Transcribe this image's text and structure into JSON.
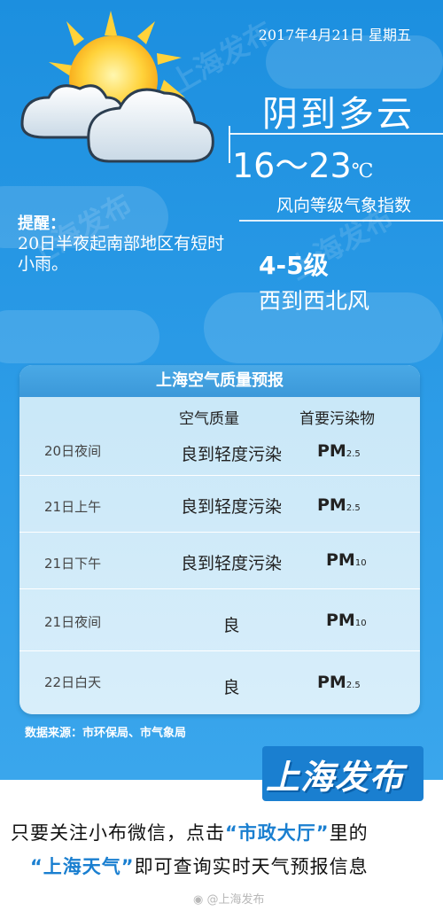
{
  "header": {
    "date": "2017年4月21日  星期五"
  },
  "forecast": {
    "weather": "阴到多云",
    "temp_range": "16～23",
    "temp_unit": "℃",
    "wind_title": "风向等级气象指数",
    "wind_level": "4-5级",
    "wind_direction": "西到西北风"
  },
  "tip": {
    "title": "提醒：",
    "text": "20日半夜起南部地区有短时小雨。"
  },
  "air_quality": {
    "title": "上海空气质量预报",
    "col_quality": "空气质量",
    "col_pollutant": "首要污染物",
    "rows": [
      {
        "period": "20日夜间",
        "quality": "良到轻度污染",
        "pollutant": "PM",
        "sub": "2.5"
      },
      {
        "period": "21日上午",
        "quality": "良到轻度污染",
        "pollutant": "PM",
        "sub": "2.5"
      },
      {
        "period": "21日下午",
        "quality": "良到轻度污染",
        "pollutant": "PM",
        "sub": "10"
      },
      {
        "period": "21日夜间",
        "quality": "良",
        "pollutant": "PM",
        "sub": "10"
      },
      {
        "period": "22日白天",
        "quality": "良",
        "pollutant": "PM",
        "sub": "2.5"
      }
    ]
  },
  "source": "数据来源：市环保局、市气象局",
  "brand": "上海发布",
  "watermark": "上海发布",
  "promo": {
    "line1_a": "只要关注小布微信，点击",
    "line1_hl": "“市政大厅”",
    "line1_b": "里的",
    "line2_hl": "“上海天气”",
    "line2_b": "即可查询实时天气预报信息"
  },
  "footer": "@上海发布",
  "colors": {
    "background": "#2a9ae6",
    "panel": "#d8eefa",
    "accent": "#1a7fd0"
  },
  "icons": [
    "sun-icon",
    "cloud-icon",
    "weibo-icon"
  ]
}
